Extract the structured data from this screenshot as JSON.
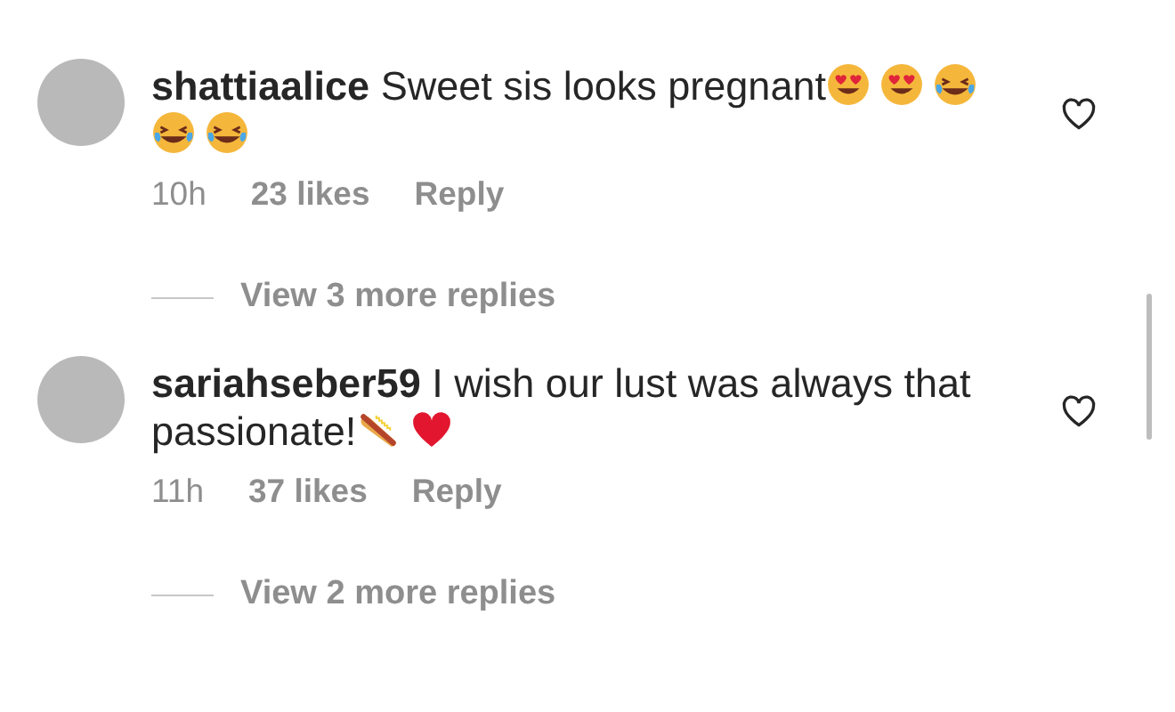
{
  "comments": [
    {
      "username": "shattiaalice",
      "text": "Sweet sis looks pregnant",
      "emojis": [
        {
          "kind": "heart-eyes"
        },
        {
          "kind": "heart-eyes"
        },
        {
          "kind": "laughing"
        },
        {
          "kind": "laughing"
        },
        {
          "kind": "laughing"
        }
      ],
      "time": "10h",
      "likes": "23 likes",
      "reply": "Reply",
      "liked": false,
      "more_replies": "View 3 more replies"
    },
    {
      "username": "sariahseber59",
      "text": "I wish our lust was always that passionate!",
      "emojis": [
        {
          "kind": "hot-dog"
        },
        {
          "kind": "heart"
        }
      ],
      "time": "11h",
      "likes": "37 likes",
      "reply": "Reply",
      "liked": false,
      "more_replies": "View 2 more replies"
    }
  ]
}
